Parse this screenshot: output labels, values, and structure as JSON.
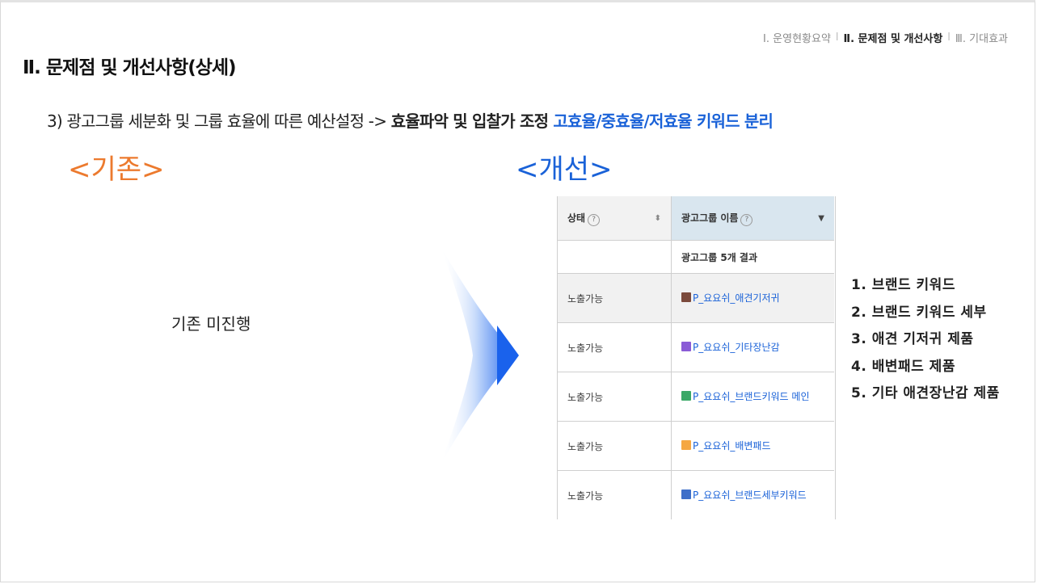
{
  "nav": {
    "item1": "Ⅰ. 운영현황요약",
    "sep1": "l",
    "item2": "Ⅱ. 문제점 및 개선사항",
    "sep2": "l",
    "item3": "Ⅲ. 기대효과"
  },
  "title": "Ⅱ. 문제점 및 개선사항(상세)",
  "subtitle": {
    "part1": "3) 광고그룹 세분화 및 그룹 효율에 따른 예산설정 -> ",
    "part2": "효율파악 및 입찰가 조정 ",
    "part3": "고효율/중효율/저효율 키워드 분리"
  },
  "before_label": "<기존>",
  "after_label": "<개선>",
  "before_text": "기존 미진행",
  "table": {
    "col_status": "상태",
    "col_name": "광고그룹 이름",
    "qmark": "?",
    "summary": "광고그룹 5개 결과",
    "rows": [
      {
        "status": "노출가능",
        "name": "P_요요쉬_애견기저귀",
        "color": "#7b4a3c"
      },
      {
        "status": "노출가능",
        "name": "P_요요쉬_기타장난감",
        "color": "#8a5bd6"
      },
      {
        "status": "노출가능",
        "name": "P_요요쉬_브랜드키워드 메인",
        "color": "#3aa867"
      },
      {
        "status": "노출가능",
        "name": "P_요요쉬_배변패드",
        "color": "#f5a742"
      },
      {
        "status": "노출가능",
        "name": "P_요요쉬_브랜드세부키워드",
        "color": "#3e6fc9"
      }
    ]
  },
  "list": [
    "1. 브랜드 키워드",
    "2. 브랜드 키워드 세부",
    "3. 애견 기저귀 제품",
    "4. 배변패드 제품",
    "5. 기타 애견장난감 제품"
  ]
}
